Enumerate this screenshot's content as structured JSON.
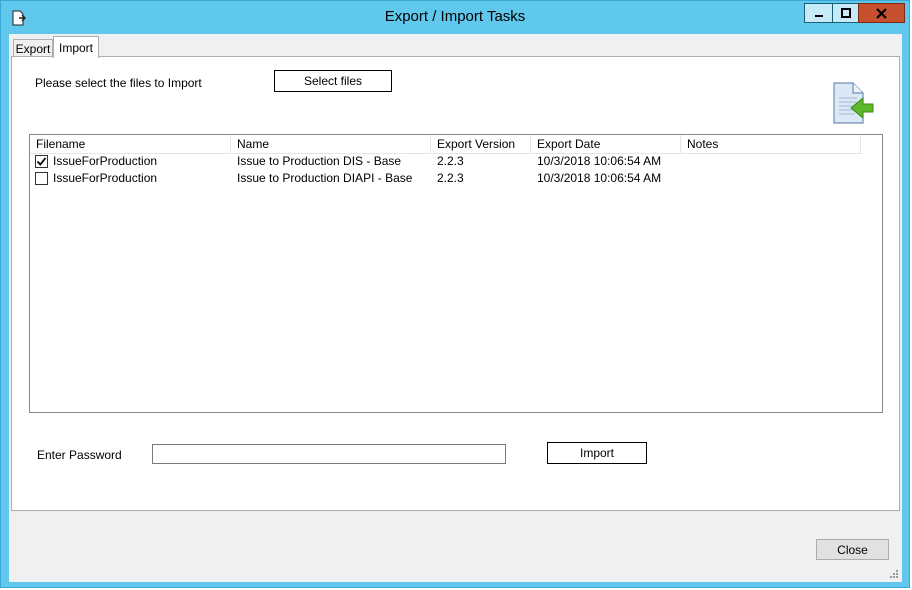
{
  "window": {
    "title": "Export / Import Tasks",
    "accent_color": "#60c8ed",
    "close_color": "#c7502e",
    "icons": {
      "app": "export-import-icon",
      "minimize": "minimize-icon",
      "maximize": "maximize-icon",
      "close": "close-icon"
    }
  },
  "tabs": [
    {
      "label": "Export",
      "selected": false
    },
    {
      "label": "Import",
      "selected": true
    }
  ],
  "import_panel": {
    "instruction": "Please select the files to Import",
    "select_files_label": "Select files",
    "illustration_icon": "import-document-icon",
    "columns": [
      "Filename",
      "Name",
      "Export Version",
      "Export Date",
      "Notes"
    ],
    "rows": [
      {
        "checked": true,
        "filename": "IssueForProduction",
        "name": "Issue to Production DIS - Base",
        "version": "2.2.3",
        "date": "10/3/2018 10:06:54 AM",
        "notes": ""
      },
      {
        "checked": false,
        "filename": "IssueForProduction",
        "name": "Issue to Production DIAPI - Base",
        "version": "2.2.3",
        "date": "10/3/2018 10:06:54 AM",
        "notes": ""
      }
    ],
    "password_label": "Enter Password",
    "password_value": "",
    "import_label": "Import"
  },
  "footer": {
    "close_label": "Close"
  }
}
